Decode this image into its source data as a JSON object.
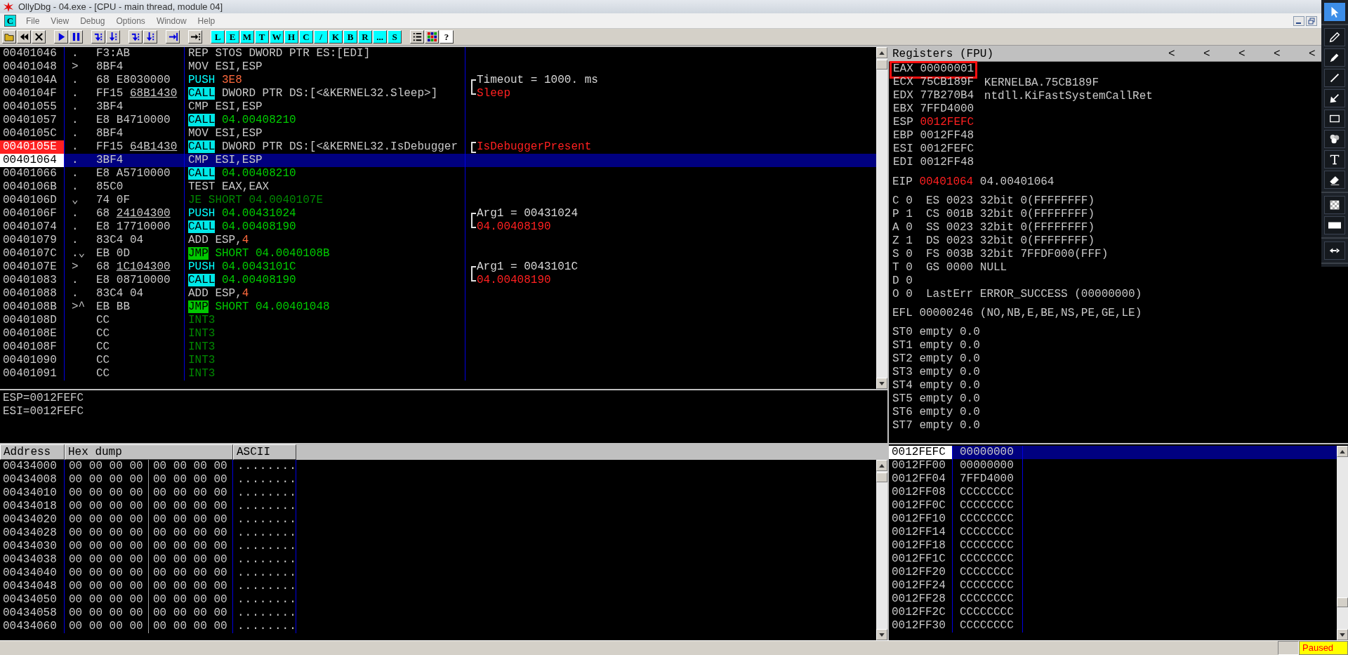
{
  "window": {
    "title": "OllyDbg - 04.exe - [CPU - main thread, module 04]"
  },
  "menu": {
    "window_icon": "C",
    "items": [
      "File",
      "View",
      "Debug",
      "Options",
      "Window",
      "Help"
    ]
  },
  "toolbar": [
    [
      {
        "kind": "open"
      },
      {
        "kind": "restart"
      },
      {
        "kind": "close"
      }
    ],
    [
      {
        "kind": "run"
      },
      {
        "kind": "pause"
      }
    ],
    [
      {
        "kind": "step_into"
      },
      {
        "kind": "step_over"
      }
    ],
    [
      {
        "kind": "trace_into"
      },
      {
        "kind": "trace_over"
      }
    ],
    [
      {
        "kind": "till_return"
      }
    ],
    [
      {
        "kind": "goto"
      }
    ],
    [
      {
        "kind": "letter",
        "label": "L"
      },
      {
        "kind": "letter",
        "label": "E"
      },
      {
        "kind": "letter",
        "label": "M"
      },
      {
        "kind": "letter",
        "label": "T"
      },
      {
        "kind": "letter",
        "label": "W"
      },
      {
        "kind": "letter",
        "label": "H"
      },
      {
        "kind": "letter",
        "label": "C"
      },
      {
        "kind": "letter",
        "label": "/"
      },
      {
        "kind": "letter",
        "label": "K"
      },
      {
        "kind": "letter",
        "label": "B"
      },
      {
        "kind": "letter",
        "label": "R"
      },
      {
        "kind": "letter",
        "label": "..."
      },
      {
        "kind": "letter",
        "label": "S"
      }
    ],
    [
      {
        "kind": "list"
      },
      {
        "kind": "windows"
      },
      {
        "kind": "help",
        "label": "?"
      }
    ]
  ],
  "disassembly": {
    "rows": [
      {
        "address": "00401046",
        "marker": ".",
        "hex": [
          {
            "text": "F3:AB",
            "kind": "plain"
          }
        ],
        "mnemonic": "REP STOS",
        "kind": "plain",
        "operand": [
          {
            "text": "DWORD PTR ES:[EDI]",
            "kind": "plain"
          }
        ],
        "selected": false,
        "breakpoint": false
      },
      {
        "address": "00401048",
        "marker": ">",
        "hex": [
          {
            "text": "8BF4",
            "kind": "plain"
          }
        ],
        "mnemonic": "MOV",
        "kind": "plain",
        "operand": [
          {
            "text": "ESI,ESP",
            "kind": "plain"
          }
        ],
        "selected": false,
        "breakpoint": false
      },
      {
        "address": "0040104A",
        "marker": ".",
        "hex": [
          {
            "text": "68 E8030000",
            "kind": "plain"
          }
        ],
        "mnemonic": "PUSH",
        "kind": "push",
        "operand": [
          {
            "text": "3E8",
            "kind": "const"
          }
        ],
        "comment": {
          "text": "Timeout = 1000. ms",
          "kind": "arg",
          "bracket_top": true,
          "bracket_bottom": false
        },
        "selected": false,
        "breakpoint": false
      },
      {
        "address": "0040104F",
        "marker": ".",
        "hex": [
          {
            "text": "FF15 ",
            "kind": "plain"
          },
          {
            "text": "68B1430",
            "kind": "fixup"
          }
        ],
        "mnemonic": "CALL",
        "kind": "call",
        "operand": [
          {
            "text": "DWORD PTR DS:[<&KERNEL32.Sleep>]",
            "kind": "plain"
          }
        ],
        "comment": {
          "text": "Sleep",
          "kind": "proc",
          "bracket_top": false,
          "bracket_bottom": true
        },
        "selected": false,
        "breakpoint": false
      },
      {
        "address": "00401055",
        "marker": ".",
        "hex": [
          {
            "text": "3BF4",
            "kind": "plain"
          }
        ],
        "mnemonic": "CMP",
        "kind": "plain",
        "operand": [
          {
            "text": "ESI,ESP",
            "kind": "plain"
          }
        ],
        "selected": false,
        "breakpoint": false
      },
      {
        "address": "00401057",
        "marker": ".",
        "hex": [
          {
            "text": "E8 B4710000",
            "kind": "plain"
          }
        ],
        "mnemonic": "CALL",
        "kind": "call",
        "operand": [
          {
            "text": "04.00408210",
            "kind": "addr"
          }
        ],
        "selected": false,
        "breakpoint": false
      },
      {
        "address": "0040105C",
        "marker": ".",
        "hex": [
          {
            "text": "8BF4",
            "kind": "plain"
          }
        ],
        "mnemonic": "MOV",
        "kind": "plain",
        "operand": [
          {
            "text": "ESI,ESP",
            "kind": "plain"
          }
        ],
        "selected": false,
        "breakpoint": false
      },
      {
        "address": "0040105E",
        "marker": ".",
        "hex": [
          {
            "text": "FF15 ",
            "kind": "plain"
          },
          {
            "text": "64B1430",
            "kind": "fixup"
          }
        ],
        "mnemonic": "CALL",
        "kind": "call",
        "operand": [
          {
            "text": "DWORD PTR DS:[<&KERNEL32.IsDebugger",
            "kind": "plain"
          }
        ],
        "comment": {
          "text": "IsDebuggerPresent",
          "kind": "proc",
          "bracket_top": true,
          "bracket_bottom": true
        },
        "selected": false,
        "breakpoint": true
      },
      {
        "address": "00401064",
        "marker": ".",
        "hex": [
          {
            "text": "3BF4",
            "kind": "plain"
          }
        ],
        "mnemonic": "CMP",
        "kind": "plain",
        "operand": [
          {
            "text": "ESI,ESP",
            "kind": "plain"
          }
        ],
        "selected": true,
        "breakpoint": false
      },
      {
        "address": "00401066",
        "marker": ".",
        "hex": [
          {
            "text": "E8 A5710000",
            "kind": "plain"
          }
        ],
        "mnemonic": "CALL",
        "kind": "call",
        "operand": [
          {
            "text": "04.00408210",
            "kind": "addr"
          }
        ],
        "selected": false,
        "breakpoint": false
      },
      {
        "address": "0040106B",
        "marker": ".",
        "hex": [
          {
            "text": "85C0",
            "kind": "plain"
          }
        ],
        "mnemonic": "TEST",
        "kind": "plain",
        "operand": [
          {
            "text": "EAX,EAX",
            "kind": "plain"
          }
        ],
        "selected": false,
        "breakpoint": false
      },
      {
        "address": "0040106D",
        "marker": "⌄",
        "hex": [
          {
            "text": "74 0F",
            "kind": "plain"
          }
        ],
        "mnemonic": "JE",
        "kind": "jcc",
        "operand": [
          {
            "text": "SHORT 04.0040107E",
            "kind": "dim"
          }
        ],
        "selected": false,
        "breakpoint": false
      },
      {
        "address": "0040106F",
        "marker": ".",
        "hex": [
          {
            "text": "68 ",
            "kind": "plain"
          },
          {
            "text": "24104300",
            "kind": "fixup"
          }
        ],
        "mnemonic": "PUSH",
        "kind": "push",
        "operand": [
          {
            "text": "04.00431024",
            "kind": "addr"
          }
        ],
        "comment": {
          "text": "Arg1 = 00431024",
          "kind": "arg",
          "bracket_top": true,
          "bracket_bottom": false
        },
        "selected": false,
        "breakpoint": false
      },
      {
        "address": "00401074",
        "marker": ".",
        "hex": [
          {
            "text": "E8 17710000",
            "kind": "plain"
          }
        ],
        "mnemonic": "CALL",
        "kind": "call",
        "operand": [
          {
            "text": "04.00408190",
            "kind": "addr"
          }
        ],
        "comment": {
          "text": "04.00408190",
          "kind": "proc",
          "bracket_top": false,
          "bracket_bottom": true
        },
        "selected": false,
        "breakpoint": false
      },
      {
        "address": "00401079",
        "marker": ".",
        "hex": [
          {
            "text": "83C4 04",
            "kind": "plain"
          }
        ],
        "mnemonic": "ADD",
        "kind": "plain",
        "operand": [
          {
            "text": "ESP,",
            "kind": "plain"
          },
          {
            "text": "4",
            "kind": "const"
          }
        ],
        "selected": false,
        "breakpoint": false
      },
      {
        "address": "0040107C",
        "marker": ".⌄",
        "hex": [
          {
            "text": "EB 0D",
            "kind": "plain"
          }
        ],
        "mnemonic": "JMP",
        "kind": "jmp",
        "operand": [
          {
            "text": "SHORT 04.0040108B",
            "kind": "addr"
          }
        ],
        "selected": false,
        "breakpoint": false
      },
      {
        "address": "0040107E",
        "marker": ">",
        "hex": [
          {
            "text": "68 ",
            "kind": "plain"
          },
          {
            "text": "1C104300",
            "kind": "fixup"
          }
        ],
        "mnemonic": "PUSH",
        "kind": "push",
        "operand": [
          {
            "text": "04.0043101C",
            "kind": "addr"
          }
        ],
        "comment": {
          "text": "Arg1 = 0043101C",
          "kind": "arg",
          "bracket_top": true,
          "bracket_bottom": false
        },
        "selected": false,
        "breakpoint": false
      },
      {
        "address": "00401083",
        "marker": ".",
        "hex": [
          {
            "text": "E8 08710000",
            "kind": "plain"
          }
        ],
        "mnemonic": "CALL",
        "kind": "call",
        "operand": [
          {
            "text": "04.00408190",
            "kind": "addr"
          }
        ],
        "comment": {
          "text": "04.00408190",
          "kind": "proc",
          "bracket_top": false,
          "bracket_bottom": true
        },
        "selected": false,
        "breakpoint": false
      },
      {
        "address": "00401088",
        "marker": ".",
        "hex": [
          {
            "text": "83C4 04",
            "kind": "plain"
          }
        ],
        "mnemonic": "ADD",
        "kind": "plain",
        "operand": [
          {
            "text": "ESP,",
            "kind": "plain"
          },
          {
            "text": "4",
            "kind": "const"
          }
        ],
        "selected": false,
        "breakpoint": false
      },
      {
        "address": "0040108B",
        "marker": ">^",
        "hex": [
          {
            "text": "EB BB",
            "kind": "plain"
          }
        ],
        "mnemonic": "JMP",
        "kind": "jmp",
        "operand": [
          {
            "text": "SHORT 04.00401048",
            "kind": "addr"
          }
        ],
        "selected": false,
        "breakpoint": false
      },
      {
        "address": "0040108D",
        "hex": [
          {
            "text": "CC",
            "kind": "plain"
          }
        ],
        "mnemonic": "INT3",
        "kind": "int3",
        "operand": [],
        "selected": false,
        "breakpoint": false
      },
      {
        "address": "0040108E",
        "hex": [
          {
            "text": "CC",
            "kind": "plain"
          }
        ],
        "mnemonic": "INT3",
        "kind": "int3",
        "operand": [],
        "selected": false,
        "breakpoint": false
      },
      {
        "address": "0040108F",
        "hex": [
          {
            "text": "CC",
            "kind": "plain"
          }
        ],
        "mnemonic": "INT3",
        "kind": "int3",
        "operand": [],
        "selected": false,
        "breakpoint": false
      },
      {
        "address": "00401090",
        "hex": [
          {
            "text": "CC",
            "kind": "plain"
          }
        ],
        "mnemonic": "INT3",
        "kind": "int3",
        "operand": [],
        "selected": false,
        "breakpoint": false
      },
      {
        "address": "00401091",
        "hex": [
          {
            "text": "CC",
            "kind": "plain"
          }
        ],
        "mnemonic": "INT3",
        "kind": "int3",
        "operand": [],
        "selected": false,
        "breakpoint": false
      }
    ]
  },
  "info": {
    "lines": [
      "ESP=0012FEFC",
      "ESI=0012FEFC"
    ]
  },
  "registers": {
    "title": "Registers (FPU)",
    "arrows": [
      "<",
      "<",
      "<",
      "<",
      "<"
    ],
    "general": [
      {
        "name": "EAX",
        "value": "00000001",
        "changed": false,
        "highlighted": true
      },
      {
        "name": "ECX",
        "value": "75CB189F",
        "changed": false,
        "highlighted": false,
        "info": "KERNELBA.75CB189F"
      },
      {
        "name": "EDX",
        "value": "77B270B4",
        "changed": false,
        "highlighted": false,
        "info": "ntdll.KiFastSystemCallRet"
      },
      {
        "name": "EBX",
        "value": "7FFD4000",
        "changed": false,
        "highlighted": false
      },
      {
        "name": "ESP",
        "value": "0012FEFC",
        "changed": true,
        "highlighted": false
      },
      {
        "name": "EBP",
        "value": "0012FF48",
        "changed": false,
        "highlighted": false
      },
      {
        "name": "ESI",
        "value": "0012FEFC",
        "changed": false,
        "highlighted": false
      },
      {
        "name": "EDI",
        "value": "0012FF48",
        "changed": false,
        "highlighted": false
      }
    ],
    "eip": {
      "name": "EIP",
      "value": "00401064",
      "changed": true,
      "info": "04.00401064"
    },
    "flags": [
      {
        "flag": "C",
        "bit": "0",
        "segment": "ES 0023 32bit 0(FFFFFFFF)"
      },
      {
        "flag": "P",
        "bit": "1",
        "segment": "CS 001B 32bit 0(FFFFFFFF)"
      },
      {
        "flag": "A",
        "bit": "0",
        "segment": "SS 0023 32bit 0(FFFFFFFF)"
      },
      {
        "flag": "Z",
        "bit": "1",
        "segment": "DS 0023 32bit 0(FFFFFFFF)"
      },
      {
        "flag": "S",
        "bit": "0",
        "segment": "FS 003B 32bit 7FFDF000(FFF)"
      },
      {
        "flag": "T",
        "bit": "0",
        "segment": "GS 0000 NULL"
      },
      {
        "flag": "D",
        "bit": "0"
      },
      {
        "flag": "O",
        "bit": "0",
        "segment": "LastErr ERROR_SUCCESS (00000000)"
      }
    ],
    "efl": {
      "name": "EFL",
      "value": "00000246",
      "info": "(NO,NB,E,BE,NS,PE,GE,LE)"
    },
    "fpu": [
      {
        "name": "ST0",
        "value": "empty 0.0"
      },
      {
        "name": "ST1",
        "value": "empty 0.0"
      },
      {
        "name": "ST2",
        "value": "empty 0.0"
      },
      {
        "name": "ST3",
        "value": "empty 0.0"
      },
      {
        "name": "ST4",
        "value": "empty 0.0"
      },
      {
        "name": "ST5",
        "value": "empty 0.0"
      },
      {
        "name": "ST6",
        "value": "empty 0.0"
      },
      {
        "name": "ST7",
        "value": "empty 0.0"
      }
    ]
  },
  "dump": {
    "columns": [
      "Address",
      "Hex dump",
      "ASCII"
    ],
    "rows": [
      {
        "address": "00434000",
        "hex": [
          "00 00 00 00",
          "00 00 00 00"
        ],
        "ascii": "........"
      },
      {
        "address": "00434008",
        "hex": [
          "00 00 00 00",
          "00 00 00 00"
        ],
        "ascii": "........"
      },
      {
        "address": "00434010",
        "hex": [
          "00 00 00 00",
          "00 00 00 00"
        ],
        "ascii": "........"
      },
      {
        "address": "00434018",
        "hex": [
          "00 00 00 00",
          "00 00 00 00"
        ],
        "ascii": "........"
      },
      {
        "address": "00434020",
        "hex": [
          "00 00 00 00",
          "00 00 00 00"
        ],
        "ascii": "........"
      },
      {
        "address": "00434028",
        "hex": [
          "00 00 00 00",
          "00 00 00 00"
        ],
        "ascii": "........"
      },
      {
        "address": "00434030",
        "hex": [
          "00 00 00 00",
          "00 00 00 00"
        ],
        "ascii": "........"
      },
      {
        "address": "00434038",
        "hex": [
          "00 00 00 00",
          "00 00 00 00"
        ],
        "ascii": "........"
      },
      {
        "address": "00434040",
        "hex": [
          "00 00 00 00",
          "00 00 00 00"
        ],
        "ascii": "........"
      },
      {
        "address": "00434048",
        "hex": [
          "00 00 00 00",
          "00 00 00 00"
        ],
        "ascii": "........"
      },
      {
        "address": "00434050",
        "hex": [
          "00 00 00 00",
          "00 00 00 00"
        ],
        "ascii": "........"
      },
      {
        "address": "00434058",
        "hex": [
          "00 00 00 00",
          "00 00 00 00"
        ],
        "ascii": "........"
      },
      {
        "address": "00434060",
        "hex": [
          "00 00 00 00",
          "00 00 00 00"
        ],
        "ascii": "........"
      }
    ]
  },
  "stack": {
    "rows": [
      {
        "address": "0012FEFC",
        "value": "00000000",
        "selected": true
      },
      {
        "address": "0012FF00",
        "value": "00000000",
        "selected": false
      },
      {
        "address": "0012FF04",
        "value": "7FFD4000",
        "selected": false
      },
      {
        "address": "0012FF08",
        "value": "CCCCCCCC",
        "selected": false
      },
      {
        "address": "0012FF0C",
        "value": "CCCCCCCC",
        "selected": false
      },
      {
        "address": "0012FF10",
        "value": "CCCCCCCC",
        "selected": false
      },
      {
        "address": "0012FF14",
        "value": "CCCCCCCC",
        "selected": false
      },
      {
        "address": "0012FF18",
        "value": "CCCCCCCC",
        "selected": false
      },
      {
        "address": "0012FF1C",
        "value": "CCCCCCCC",
        "selected": false
      },
      {
        "address": "0012FF20",
        "value": "CCCCCCCC",
        "selected": false
      },
      {
        "address": "0012FF24",
        "value": "CCCCCCCC",
        "selected": false
      },
      {
        "address": "0012FF28",
        "value": "CCCCCCCC",
        "selected": false
      },
      {
        "address": "0012FF2C",
        "value": "CCCCCCCC",
        "selected": false
      },
      {
        "address": "0012FF30",
        "value": "CCCCCCCC",
        "selected": false
      }
    ]
  },
  "status_bar": {
    "state": "Paused"
  },
  "annotation_toolbar": [
    [
      {
        "kind": "pointer",
        "selected": true
      }
    ],
    [
      {
        "kind": "pencil",
        "selected": false
      },
      {
        "kind": "marker",
        "selected": false
      },
      {
        "kind": "line",
        "selected": false
      },
      {
        "kind": "arrow",
        "selected": false
      },
      {
        "kind": "rectangle",
        "selected": false
      },
      {
        "kind": "numbers",
        "selected": false
      },
      {
        "kind": "text",
        "selected": false
      },
      {
        "kind": "eraser",
        "selected": false
      }
    ],
    [
      {
        "kind": "opacity",
        "selected": false
      },
      {
        "kind": "line_width",
        "selected": false
      }
    ],
    [
      {
        "kind": "swap",
        "selected": false
      }
    ]
  ]
}
